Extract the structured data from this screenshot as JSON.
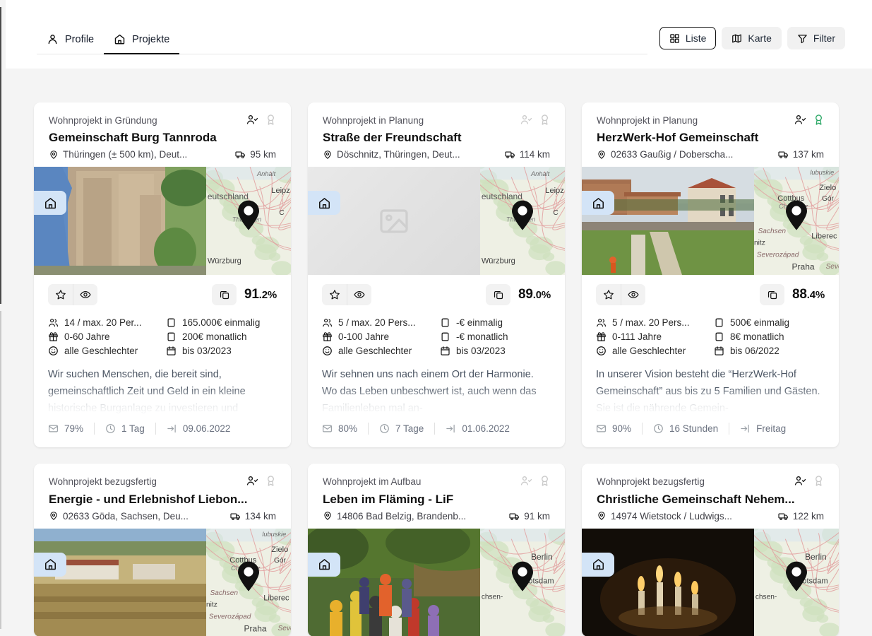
{
  "header": {
    "tabs": [
      {
        "label": "Profile",
        "icon": "user-icon",
        "active": false
      },
      {
        "label": "Projekte",
        "icon": "home-icon",
        "active": true
      }
    ],
    "actions": [
      {
        "label": "Liste",
        "icon": "grid-icon",
        "style": "outlined"
      },
      {
        "label": "Karte",
        "icon": "map-icon",
        "style": "filled"
      },
      {
        "label": "Filter",
        "icon": "funnel-icon",
        "style": "filled"
      }
    ]
  },
  "cards": [
    {
      "kicker": "Wohnprojekt in Gründung",
      "title": "Gemeinschaft Burg Tannroda",
      "location": "Thüringen (± 500 km), Deut...",
      "distance": "95 km",
      "verified": true,
      "award": false,
      "match": {
        "whole": "91",
        "decimal": ".2%"
      },
      "facts": [
        {
          "icon": "people-icon",
          "text": "14 / max. 20 Per..."
        },
        {
          "icon": "clipboard-icon",
          "text": "165.000€ einmalig"
        },
        {
          "icon": "gift-icon",
          "text": "0-60 Jahre"
        },
        {
          "icon": "clipboard-icon",
          "text": "200€ monatlich"
        },
        {
          "icon": "smiley-icon",
          "text": "alle Geschlechter"
        },
        {
          "icon": "calendar-icon",
          "text": "bis 03/2023"
        }
      ],
      "description": "Wir suchen Menschen, die bereit sind, gemeinschaftlich Zeit und Geld in ein kleine historische Burganlage zu investieren und",
      "footer": [
        {
          "icon": "mail-icon",
          "text": "79%"
        },
        {
          "icon": "clock-icon",
          "text": "1 Tag"
        },
        {
          "icon": "login-icon",
          "text": "09.06.2022"
        }
      ],
      "photo": "burg-photo",
      "map": "thueringen-map"
    },
    {
      "kicker": "Wohnprojekt in Planung",
      "title": "Straße der Freundschaft",
      "location": "Döschnitz, Thüringen, Deut...",
      "distance": "114 km",
      "verified": false,
      "award": false,
      "match": {
        "whole": "89",
        "decimal": ".0%"
      },
      "facts": [
        {
          "icon": "people-icon",
          "text": "5 / max. 20 Pers..."
        },
        {
          "icon": "clipboard-icon",
          "text": "-€ einmalig"
        },
        {
          "icon": "gift-icon",
          "text": "0-100 Jahre"
        },
        {
          "icon": "clipboard-icon",
          "text": "-€ monatlich"
        },
        {
          "icon": "smiley-icon",
          "text": "alle Geschlechter"
        },
        {
          "icon": "calendar-icon",
          "text": "bis 03/2023"
        }
      ],
      "description": "Wir sehnen uns nach einem Ort der Harmonie. Wo das Leben unbeschwert ist, auch wenn das Familienleben mal an-",
      "footer": [
        {
          "icon": "mail-icon",
          "text": "80%"
        },
        {
          "icon": "clock-icon",
          "text": "7 Tage"
        },
        {
          "icon": "login-icon",
          "text": "01.06.2022"
        }
      ],
      "photo": "placeholder-photo",
      "map": "thueringen-map"
    },
    {
      "kicker": "Wohnprojekt in Planung",
      "title": "HerzWerk-Hof Gemeinschaft",
      "location": "02633 Gaußig / Doberscha...",
      "distance": "137 km",
      "verified": true,
      "award": true,
      "match": {
        "whole": "88",
        "decimal": ".4%"
      },
      "facts": [
        {
          "icon": "people-icon",
          "text": "5 / max. 20 Pers..."
        },
        {
          "icon": "clipboard-icon",
          "text": "500€ einmalig"
        },
        {
          "icon": "gift-icon",
          "text": "0-111 Jahre"
        },
        {
          "icon": "clipboard-icon",
          "text": "8€ monatlich"
        },
        {
          "icon": "smiley-icon",
          "text": "alle Geschlechter"
        },
        {
          "icon": "calendar-icon",
          "text": "bis 06/2022"
        }
      ],
      "description": "In unserer Vision besteht die “HerzWerk-Hof Gemeinschaft” aus bis zu 5 Familien und Gästen. Sie ist die nährende Gemein-",
      "footer": [
        {
          "icon": "mail-icon",
          "text": "90%"
        },
        {
          "icon": "clock-icon",
          "text": "16 Stunden"
        },
        {
          "icon": "login-icon",
          "text": "Freitag"
        }
      ],
      "photo": "hof-photo",
      "map": "sachsen-map"
    },
    {
      "kicker": "Wohnprojekt bezugsfertig",
      "title": "Energie - und Erlebnishof Liebon...",
      "location": "02633 Göda, Sachsen, Deu...",
      "distance": "134 km",
      "verified": true,
      "award": false,
      "match": {
        "whole": "",
        "decimal": ""
      },
      "facts": [],
      "description": "",
      "footer": [],
      "photo": "aerial-photo",
      "map": "sachsen-map"
    },
    {
      "kicker": "Wohnprojekt im Aufbau",
      "title": "Leben im Fläming - LiF",
      "location": "14806 Bad Belzig, Brandenb...",
      "distance": "91 km",
      "verified": false,
      "award": false,
      "match": {
        "whole": "",
        "decimal": ""
      },
      "facts": [],
      "description": "",
      "footer": [],
      "photo": "group-photo",
      "map": "berlin-map"
    },
    {
      "kicker": "Wohnprojekt bezugsfertig",
      "title": "Christliche Gemeinschaft Nehem...",
      "location": "14974 Wietstock / Ludwigs...",
      "distance": "122 km",
      "verified": true,
      "award": false,
      "match": {
        "whole": "",
        "decimal": ""
      },
      "facts": [],
      "description": "",
      "footer": [],
      "photo": "candle-photo",
      "map": "berlin-map"
    }
  ],
  "colors": {
    "accent_award": "#2aa765",
    "badge_bg": "#d3e4f7",
    "page_bg": "#f4f4f4",
    "card_bg": "#ffffff",
    "text_primary": "#111111",
    "text_muted": "#6b7280"
  }
}
